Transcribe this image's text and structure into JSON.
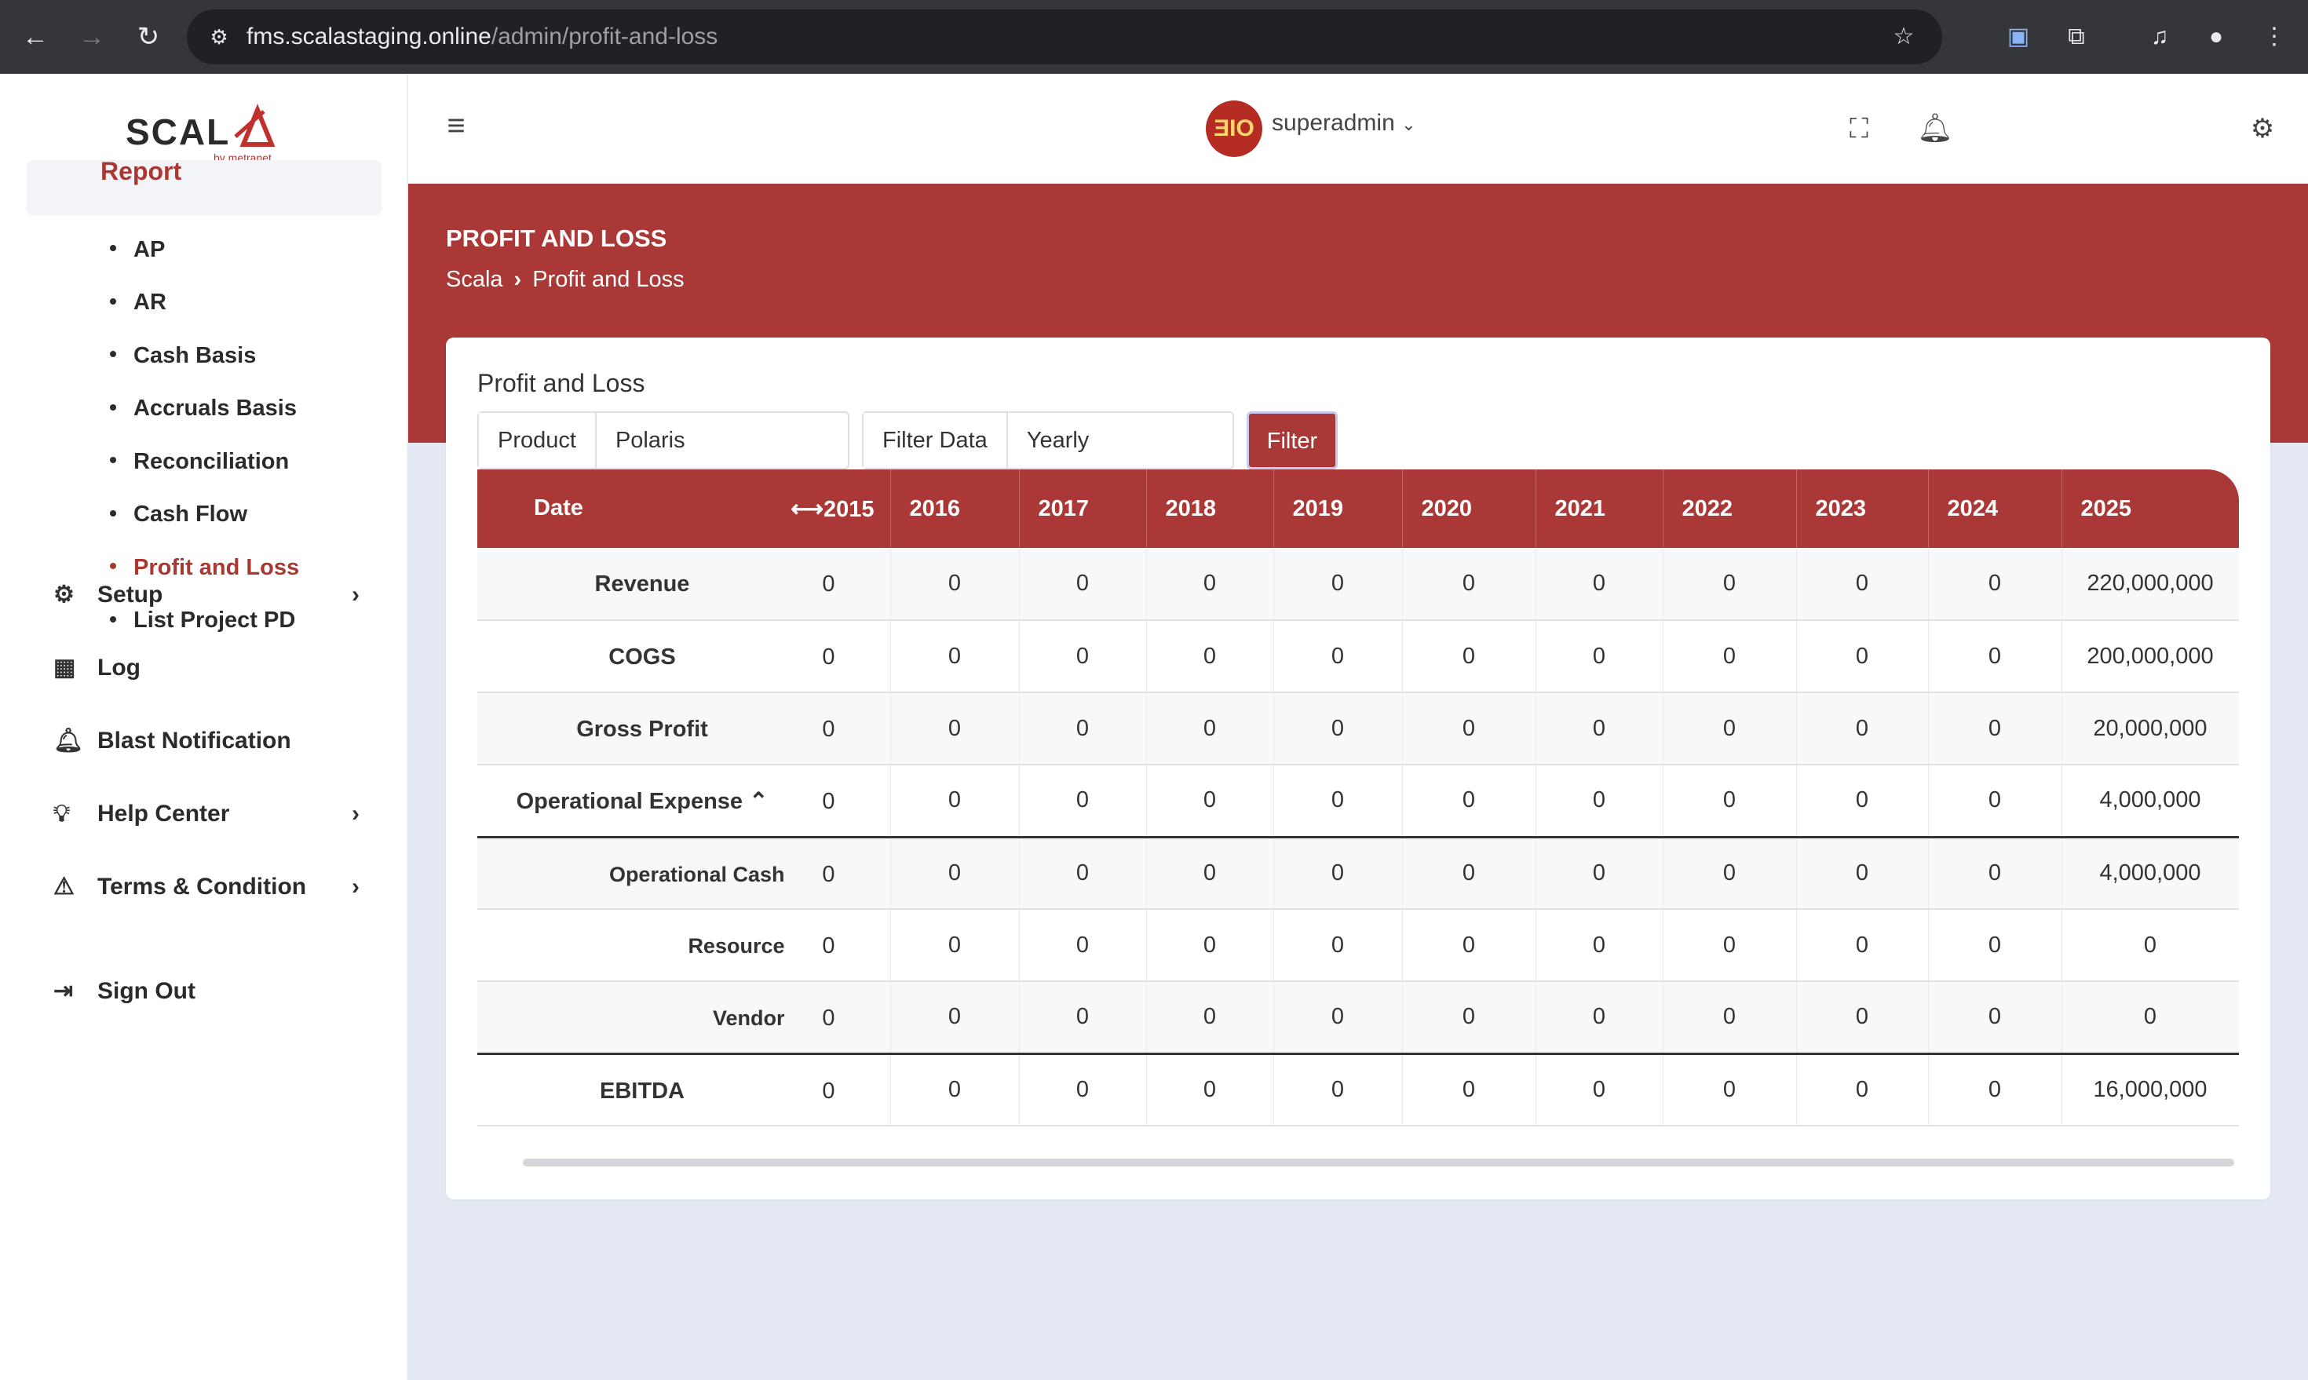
{
  "browser": {
    "url_host": "fms.scalastaging.online",
    "url_path": "/admin/profit-and-loss"
  },
  "sidebar": {
    "logo_text": "SCALA",
    "logo_sub": "by metranet",
    "report_label": "Report",
    "sub_items": [
      {
        "label": "AP",
        "active": false
      },
      {
        "label": "AR",
        "active": false
      },
      {
        "label": "Cash Basis",
        "active": false
      },
      {
        "label": "Accruals Basis",
        "active": false
      },
      {
        "label": "Reconciliation",
        "active": false
      },
      {
        "label": "Cash Flow",
        "active": false
      },
      {
        "label": "Profit and Loss",
        "active": true
      },
      {
        "label": "List Project PD",
        "active": false
      }
    ],
    "menu": [
      {
        "label": "Setup",
        "icon": "gear-icon",
        "has_chevron": true
      },
      {
        "label": "Log",
        "icon": "calendar-icon",
        "has_chevron": false
      },
      {
        "label": "Blast Notification",
        "icon": "bell-icon",
        "has_chevron": false
      },
      {
        "label": "Help Center",
        "icon": "lightbulb-icon",
        "has_chevron": true
      },
      {
        "label": "Terms & Condition",
        "icon": "warning-icon",
        "has_chevron": true
      },
      {
        "label": "Sign Out",
        "icon": "sign-out-icon",
        "has_chevron": false
      }
    ]
  },
  "header": {
    "username": "superadmin",
    "avatar_text": "ƎIO"
  },
  "page": {
    "title": "PROFIT AND LOSS",
    "breadcrumb": [
      "Scala",
      "Profit and Loss"
    ]
  },
  "card": {
    "title": "Profit and Loss",
    "product_label": "Product",
    "product_value": "Polaris",
    "filter_data_label": "Filter Data",
    "filter_data_value": "Yearly",
    "filter_button": "Filter"
  },
  "table": {
    "date_header": "Date",
    "first_year_header": "⟷2015",
    "years": [
      "2016",
      "2017",
      "2018",
      "2019",
      "2020",
      "2021",
      "2022",
      "2023",
      "2024",
      "2025"
    ],
    "rows": [
      {
        "label": "Revenue",
        "type": "main",
        "values": [
          "0",
          "0",
          "0",
          "0",
          "0",
          "0",
          "0",
          "0",
          "0",
          "0",
          "220,000,000"
        ]
      },
      {
        "label": "COGS",
        "type": "main",
        "values": [
          "0",
          "0",
          "0",
          "0",
          "0",
          "0",
          "0",
          "0",
          "0",
          "0",
          "200,000,000"
        ]
      },
      {
        "label": "Gross Profit",
        "type": "main",
        "values": [
          "0",
          "0",
          "0",
          "0",
          "0",
          "0",
          "0",
          "0",
          "0",
          "0",
          "20,000,000"
        ]
      },
      {
        "label": "Operational Expense ⌃",
        "type": "main",
        "values": [
          "0",
          "0",
          "0",
          "0",
          "0",
          "0",
          "0",
          "0",
          "0",
          "0",
          "4,000,000"
        ]
      },
      {
        "label": "Operational Cash",
        "type": "sub",
        "values": [
          "0",
          "0",
          "0",
          "0",
          "0",
          "0",
          "0",
          "0",
          "0",
          "0",
          "4,000,000"
        ]
      },
      {
        "label": "Resource",
        "type": "sub",
        "values": [
          "0",
          "0",
          "0",
          "0",
          "0",
          "0",
          "0",
          "0",
          "0",
          "0",
          "0"
        ]
      },
      {
        "label": "Vendor",
        "type": "sub",
        "values": [
          "0",
          "0",
          "0",
          "0",
          "0",
          "0",
          "0",
          "0",
          "0",
          "0",
          "0"
        ]
      },
      {
        "label": "EBITDA",
        "type": "main",
        "values": [
          "0",
          "0",
          "0",
          "0",
          "0",
          "0",
          "0",
          "0",
          "0",
          "0",
          "16,000,000"
        ]
      }
    ]
  },
  "colors": {
    "brand": "#a93836",
    "background": "#e4e9f4"
  }
}
